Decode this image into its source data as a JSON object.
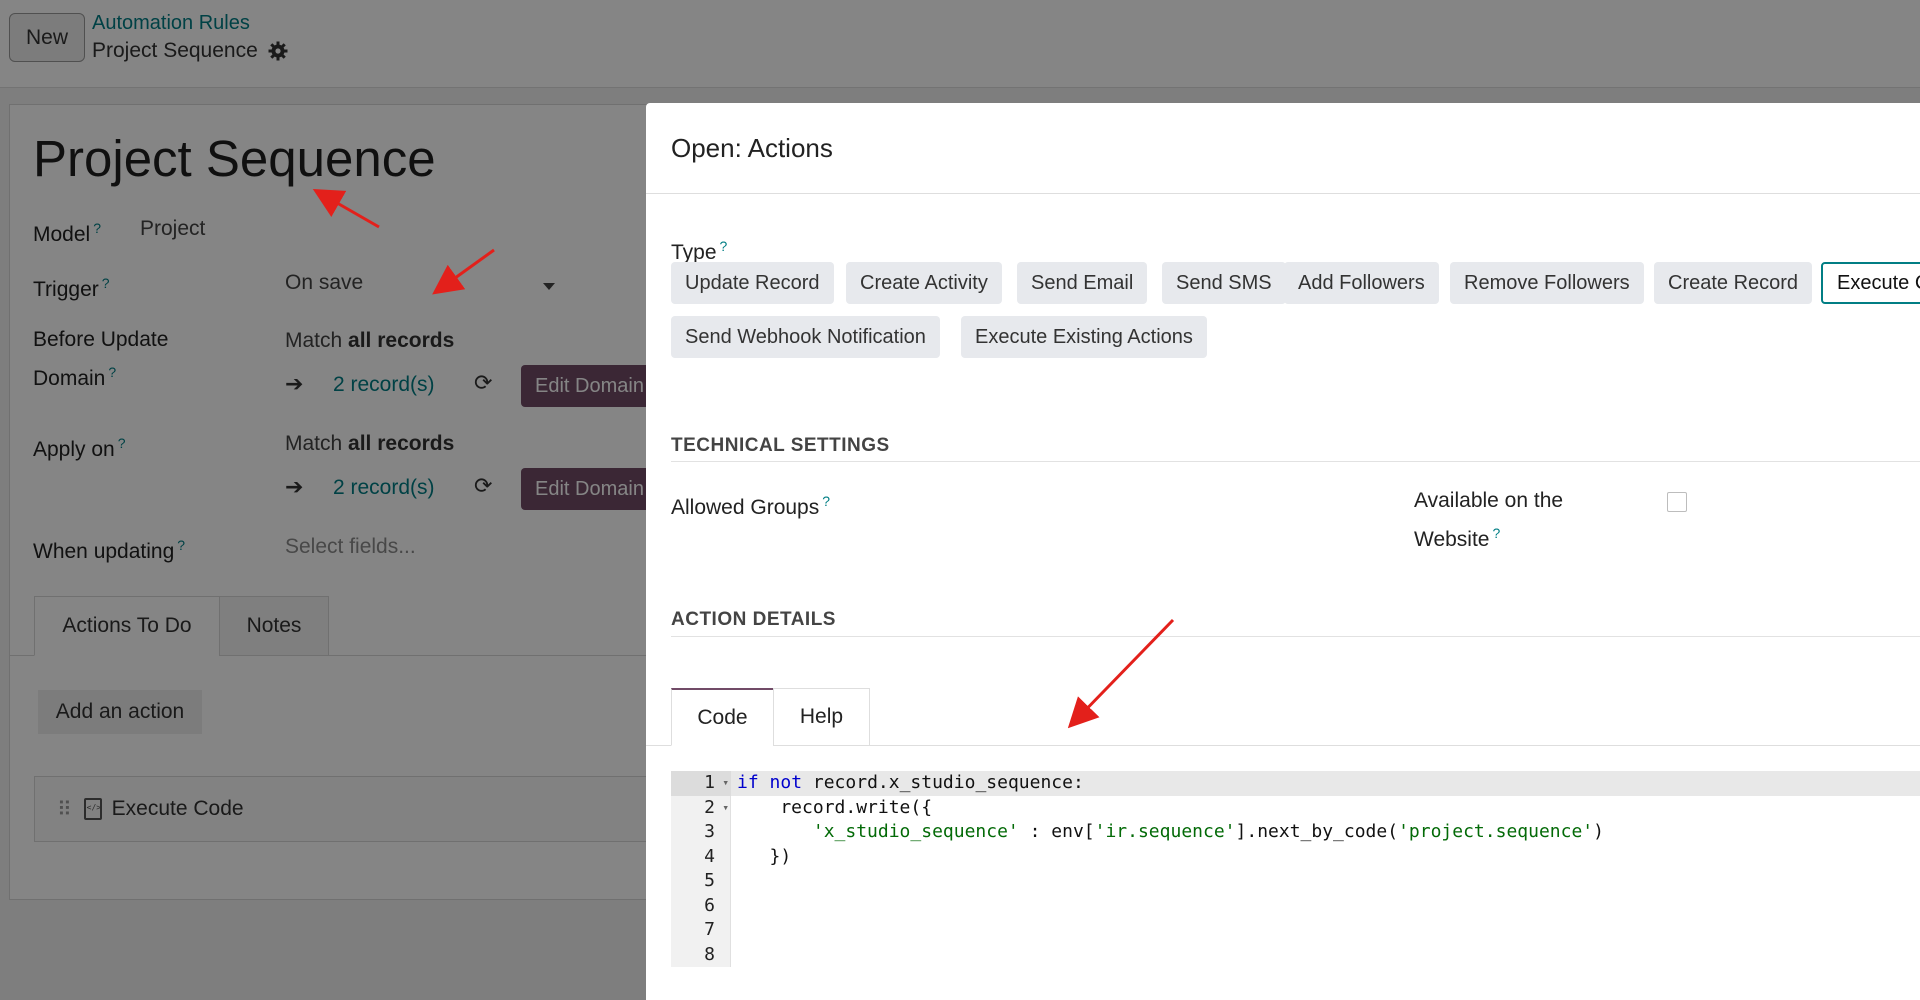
{
  "topbar": {
    "new_label": "New",
    "breadcrumb_parent": "Automation Rules",
    "breadcrumb_current": "Project Sequence"
  },
  "form": {
    "title": "Project Sequence",
    "model_label": "Model",
    "model_value": "Project",
    "trigger_label": "Trigger",
    "trigger_value": "On save",
    "before_update_label_1": "Before Update",
    "before_update_label_2": "Domain",
    "match_prefix": "Match",
    "match_bold": "all records",
    "records_link": "2 record(s)",
    "edit_domain_label": "Edit Domain",
    "apply_on_label": "Apply on",
    "when_updating_label": "When updating",
    "when_updating_placeholder": "Select fields...",
    "tabs": [
      "Actions To Do",
      "Notes"
    ],
    "add_action_label": "Add an action",
    "action_item": "Execute Code"
  },
  "modal": {
    "title": "Open: Actions",
    "type_label": "Type",
    "type_buttons": [
      "Update Record",
      "Create Activity",
      "Send Email",
      "Send SMS",
      "Add Followers",
      "Remove Followers",
      "Create Record",
      "Execute Code"
    ],
    "type_buttons_row2": [
      "Send Webhook Notification",
      "Execute Existing Actions"
    ],
    "selected_type": "Execute Code",
    "technical_settings": "TECHNICAL SETTINGS",
    "allowed_groups_label": "Allowed Groups",
    "website_label_1": "Available on the",
    "website_label_2": "Website",
    "action_details": "ACTION DETAILS",
    "code_tabs": [
      "Code",
      "Help"
    ],
    "code_lines": [
      "if not record.x_studio_sequence:",
      "    record.write({",
      "       'x_studio_sequence' : env['ir.sequence'].next_by_code('project.sequence')",
      "   })",
      "",
      "",
      "",
      ""
    ],
    "line_numbers": [
      "1",
      "2",
      "3",
      "4",
      "5",
      "6",
      "7",
      "8"
    ]
  },
  "colors": {
    "accent_teal": "#017e84",
    "brand_purple": "#714b67",
    "annotation_red": "#e3201b"
  }
}
